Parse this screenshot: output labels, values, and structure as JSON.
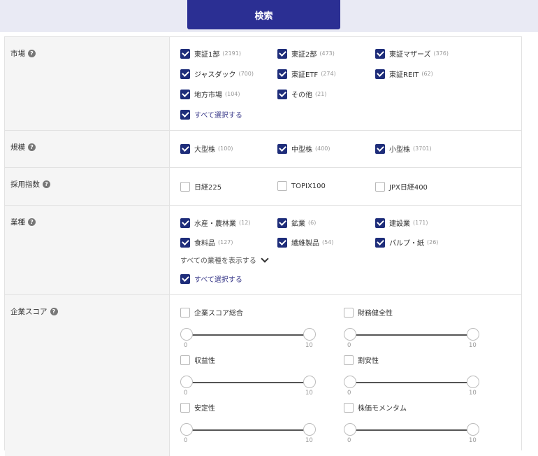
{
  "search_button": "検索",
  "market": {
    "label": "市場",
    "options": [
      {
        "name": "東証1部",
        "count": "(2191)",
        "checked": true
      },
      {
        "name": "東証2部",
        "count": "(473)",
        "checked": true
      },
      {
        "name": "東証マザーズ",
        "count": "(376)",
        "checked": true
      },
      {
        "name": "ジャスダック",
        "count": "(700)",
        "checked": true
      },
      {
        "name": "東証ETF",
        "count": "(274)",
        "checked": true
      },
      {
        "name": "東証REIT",
        "count": "(62)",
        "checked": true
      },
      {
        "name": "地方市場",
        "count": "(104)",
        "checked": true
      },
      {
        "name": "その他",
        "count": "(21)",
        "checked": true
      }
    ],
    "select_all": "すべて選択する"
  },
  "scale": {
    "label": "規模",
    "options": [
      {
        "name": "大型株",
        "count": "(100)",
        "checked": true
      },
      {
        "name": "中型株",
        "count": "(400)",
        "checked": true
      },
      {
        "name": "小型株",
        "count": "(3701)",
        "checked": true
      }
    ]
  },
  "index": {
    "label": "採用指数",
    "options": [
      {
        "name": "日経225",
        "checked": false
      },
      {
        "name": "TOPIX100",
        "checked": false
      },
      {
        "name": "JPX日経400",
        "checked": false
      }
    ]
  },
  "industry": {
    "label": "業種",
    "options": [
      {
        "name": "水産・農林業",
        "count": "(12)",
        "checked": true
      },
      {
        "name": "鉱業",
        "count": "(6)",
        "checked": true
      },
      {
        "name": "建設業",
        "count": "(171)",
        "checked": true
      },
      {
        "name": "食料品",
        "count": "(127)",
        "checked": true
      },
      {
        "name": "繊維製品",
        "count": "(54)",
        "checked": true
      },
      {
        "name": "パルプ・紙",
        "count": "(26)",
        "checked": true
      }
    ],
    "show_all": "すべての業種を表示する",
    "select_all": "すべて選択する"
  },
  "score": {
    "label": "企業スコア",
    "items": [
      {
        "name": "企業スコア総合",
        "checked": false,
        "min": "0",
        "max": "10"
      },
      {
        "name": "財務健全性",
        "checked": false,
        "min": "0",
        "max": "10"
      },
      {
        "name": "収益性",
        "checked": false,
        "min": "0",
        "max": "10"
      },
      {
        "name": "割安性",
        "checked": false,
        "min": "0",
        "max": "10"
      },
      {
        "name": "安定性",
        "checked": false,
        "min": "0",
        "max": "10"
      },
      {
        "name": "株価モメンタム",
        "checked": false,
        "min": "0",
        "max": "10"
      }
    ]
  },
  "help_glyph": "?"
}
